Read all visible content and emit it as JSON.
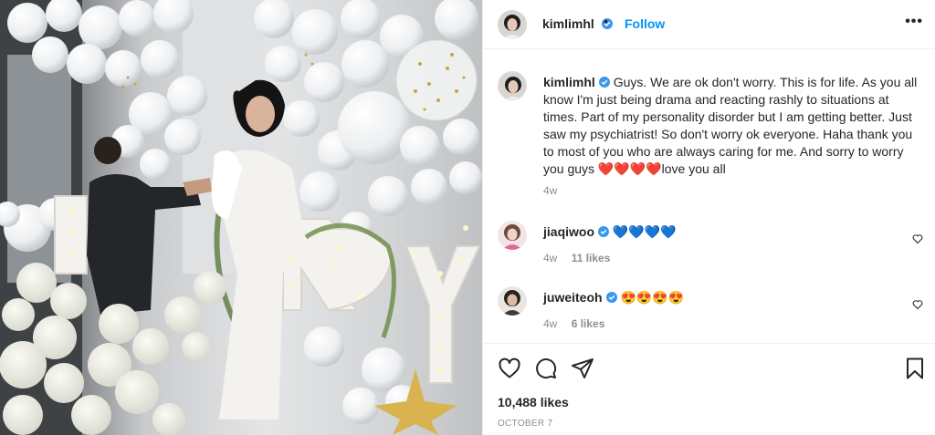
{
  "header": {
    "username": "kimlimhl",
    "separator": "•",
    "follow_label": "Follow",
    "more_label": "•••"
  },
  "caption": {
    "username": "kimlimhl",
    "text": "Guys. We are ok don't worry. This is for life. As you all know I'm just being drama and reacting rashly to situations at times. Part of my personality disorder but I am getting better. Just saw my psychiatrist! So don't worry ok everyone. Haha thank you to most of you who are always caring for me. And sorry to worry you guys ❤️❤️❤️❤️love you all",
    "time": "4w"
  },
  "comments": [
    {
      "username": "jiaqiwoo",
      "text": "💙💙💙💙",
      "time": "4w",
      "likes": "11 likes"
    },
    {
      "username": "juweiteoh",
      "text": "😍😍😍😍",
      "time": "4w",
      "likes": "6 likes"
    }
  ],
  "footer": {
    "likes": "10,488 likes",
    "date": "OCTOBER 7"
  },
  "colors": {
    "accent": "#0095f6",
    "verified": "#3897f0",
    "muted": "#8e8e8e"
  },
  "icons": [
    "verified-badge-icon",
    "more-options-icon",
    "heart-icon",
    "comment-icon",
    "share-icon",
    "bookmark-icon"
  ],
  "photo": {
    "marquee_letters": [
      "M",
      "R",
      "R",
      "Y"
    ]
  }
}
